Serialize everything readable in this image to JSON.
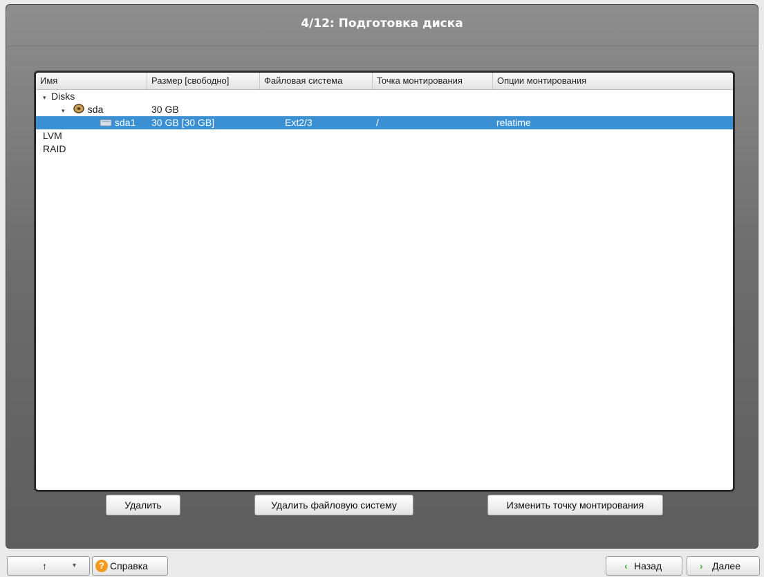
{
  "window": {
    "title": "4/12: Подготовка диска"
  },
  "table": {
    "columns": [
      "Имя",
      "Размер [свободно]",
      "Файловая система",
      "Точка монтирования",
      "Опции монтирования"
    ],
    "rows": [
      {
        "level": 0,
        "expander": "▾",
        "name": "Disks",
        "size": "",
        "fs": "",
        "mount": "",
        "options": ""
      },
      {
        "level": 1,
        "expander": "▾",
        "icon": "hard-disk-icon",
        "name": "sda",
        "size": "30 GB",
        "fs": "",
        "mount": "",
        "options": ""
      },
      {
        "level": 2,
        "icon": "partition-icon",
        "name": "sda1",
        "size": "30 GB [30 GB]",
        "fs": "Ext2/3",
        "mount": "/",
        "options": "relatime",
        "selected": true
      },
      {
        "level": 0,
        "name": "LVM",
        "size": "",
        "fs": "",
        "mount": "",
        "options": ""
      },
      {
        "level": 0,
        "name": "RAID",
        "size": "",
        "fs": "",
        "mount": "",
        "options": ""
      }
    ]
  },
  "buttons": {
    "delete": "Удалить",
    "delete_fs": "Удалить файловую систему",
    "change_mount": "Изменить точку монтирования"
  },
  "bottom": {
    "up_arrow": "↑",
    "dropdown_arrow": "▾",
    "help": "Справка",
    "back": "Назад",
    "next": "Далее"
  },
  "colors": {
    "selection": "#3b8fd3",
    "help_icon": "#f29a1f",
    "nav_arrow": "#4caf2a"
  }
}
